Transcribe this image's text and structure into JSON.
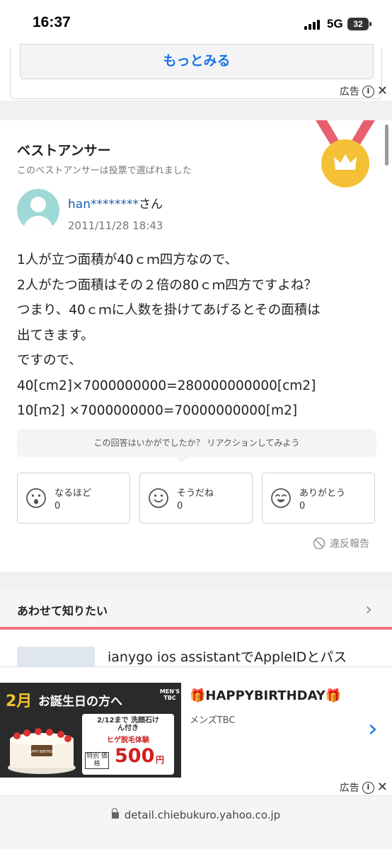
{
  "status_bar": {
    "time": "16:37",
    "network": "5G",
    "battery": "32"
  },
  "top_card": {
    "more_label": "もっとみる"
  },
  "ad_marker": {
    "label": "広告",
    "info": "i",
    "close": "✕"
  },
  "best_answer": {
    "title": "ベストアンサー",
    "subtitle": "このベストアンサーは投票で選ばれました",
    "user_name": "han********",
    "user_suffix": "さん",
    "date": "2011/11/28 18:43",
    "body": "1人が立つ面積が40ｃｍ四方なので、\n2人がたつ面積はその２倍の80ｃｍ四方ですよね？\nつまり、40ｃｍに人数を掛けてあげるとその面積は\n出てきます。\nですので、\n40[cm2]×7000000000=280000000000[cm2]\n10[m2] ×7000000000=70000000000[m2]",
    "reaction_prompt": "この回答はいかがでしたか？ リアクションしてみよう",
    "reactions": [
      {
        "label": "なるほど",
        "count": "0",
        "icon": "surprised-face-icon"
      },
      {
        "label": "そうだね",
        "count": "0",
        "icon": "smile-face-icon"
      },
      {
        "label": "ありがとう",
        "count": "0",
        "icon": "happy-face-icon"
      }
    ],
    "report_label": "違反報告"
  },
  "related": {
    "title": "あわせて知りたい",
    "item_text": "ianygo ios assistantでAppleIDとパス"
  },
  "ad_banner": {
    "month": "2月",
    "birthday_line": "お誕生日の方へ",
    "brand_badge": "MEN'S TBC",
    "date_line": "2/12まで 洗顔石けん付き",
    "offer": "ヒゲ脱毛体験",
    "price_label": "特別 価格",
    "price": "500",
    "price_unit": "円",
    "cake_text": "HAPPY BIRTHDAY",
    "headline": "🎁HAPPYBIRTHDAY🎁",
    "advertiser": "メンズTBC",
    "colors": {
      "accent": "#d21f1f",
      "link": "#1a73e8"
    }
  },
  "url_bar": {
    "url": "detail.chiebukuro.yahoo.co.jp"
  },
  "colors": {
    "link_blue": "#1a73e8",
    "related_divider": "#f2727c",
    "medal_gold": "#f4c136",
    "medal_ribbon": "#e8606d"
  }
}
